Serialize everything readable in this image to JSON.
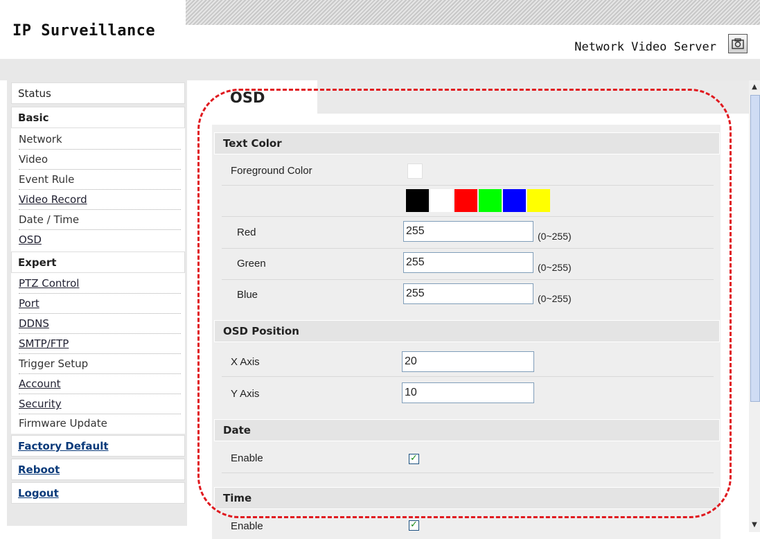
{
  "header": {
    "brand": "IP Surveillance",
    "product": "Network Video Server",
    "camera_icon": "camera-icon"
  },
  "sidebar": {
    "status": "Status",
    "basic": "Basic",
    "basic_items": [
      "Network",
      "Video",
      "Event Rule",
      "Video Record",
      "Date / Time",
      "OSD"
    ],
    "expert": "Expert",
    "expert_items": [
      "PTZ Control",
      "Port",
      "DDNS",
      "SMTP/FTP",
      "Trigger Setup",
      "Account",
      "Security",
      "Firmware Update"
    ],
    "factory_default": "Factory Default",
    "reboot": "Reboot",
    "logout": "Logout"
  },
  "main": {
    "tab_title": "OSD",
    "text_color": {
      "title": "Text Color",
      "foreground_label": "Foreground Color",
      "foreground_value": "#ffffff",
      "palette": [
        "#000000",
        "#ffffff",
        "#ff0000",
        "#00ff00",
        "#0000ff",
        "#ffff00"
      ],
      "red_label": "Red",
      "red_value": "255",
      "green_label": "Green",
      "green_value": "255",
      "blue_label": "Blue",
      "blue_value": "255",
      "range": "(0~255)"
    },
    "osd_position": {
      "title": "OSD Position",
      "x_label": "X Axis",
      "x_value": "20",
      "y_label": "Y Axis",
      "y_value": "10"
    },
    "date": {
      "title": "Date",
      "enable_label": "Enable",
      "enabled": true
    },
    "time": {
      "title": "Time",
      "enable_label": "Enable",
      "enabled": true
    }
  },
  "colors": {
    "highlight": "#e0191f",
    "link": "#0a3a7a"
  }
}
